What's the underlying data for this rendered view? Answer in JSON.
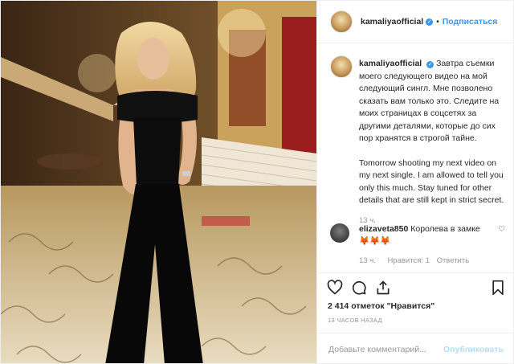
{
  "post": {
    "username": "kamaliyaofficial",
    "follow_label": "Подписаться",
    "caption_ru": "Завтра съемки моего следующего видео на мой следующий сингл. Мне позволено сказать вам только это. Следите на моих страницах в соцсетях за другими деталями, которые до сих пор хранятся в строгой тайне.",
    "caption_en": "Tomorrow shooting my next video on my next single. I am allowed to tell you only this much. Stay tuned for other details that are still kept in strict secret.",
    "caption_time": "13 ч.",
    "comment": {
      "user": "elizaveta850",
      "text": "Королева в замке",
      "emojis": "🦊🦊🦊",
      "time": "13 ч.",
      "likes": "Нравится: 1",
      "reply": "Ответить"
    },
    "likes_count": "2 414 отметок \"Нравится\"",
    "time_ago": "13 ЧАСОВ НАЗАД",
    "add_comment_placeholder": "Добавьте комментарий...",
    "publish_label": "Опубликовать",
    "icons": [
      "heart-icon",
      "comment-icon",
      "share-icon",
      "bookmark-icon",
      "verified-icon"
    ],
    "colors": {
      "link": "#3897f0",
      "muted": "#999999",
      "publish_disabled": "#b2dffc"
    }
  }
}
